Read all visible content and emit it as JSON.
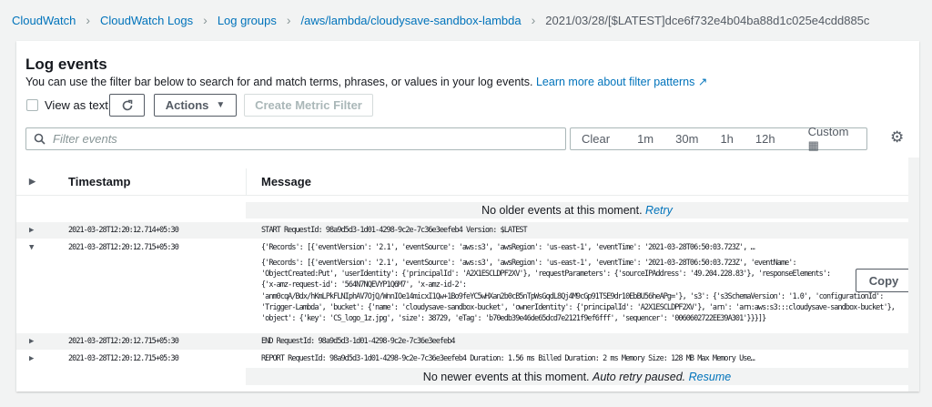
{
  "breadcrumb": [
    "CloudWatch",
    "CloudWatch Logs",
    "Log groups",
    "/aws/lambda/cloudysave-sandbox-lambda",
    "2021/03/28/[$LATEST]dce6f732e4b04ba88d1c025e4cdd885c"
  ],
  "panel": {
    "title": "Log events",
    "description": "You can use the filter bar below to search for and match terms, phrases, or values in your log events.",
    "learn_more": "Learn more about filter patterns"
  },
  "toolbar": {
    "view_as_text": "View as text",
    "actions": "Actions",
    "create_metric_filter": "Create Metric Filter"
  },
  "filter": {
    "placeholder": "Filter events",
    "ranges": [
      "Clear",
      "1m",
      "30m",
      "1h",
      "12h",
      "Custom"
    ]
  },
  "table": {
    "headers": [
      "Timestamp",
      "Message"
    ],
    "no_older": "No older events at this moment.",
    "retry": "Retry",
    "rows": [
      {
        "timestamp": "2021-03-28T12:20:12.714+05:30",
        "message": "START RequestId: 98a9d5d3-1d01-4298-9c2e-7c36e3eefeb4 Version: $LATEST"
      },
      {
        "timestamp": "2021-03-28T12:20:12.715+05:30",
        "message": "{'Records': [{'eventVersion': '2.1', 'eventSource': 'aws:s3', 'awsRegion': 'us-east-1', 'eventTime': '2021-03-28T06:50:03.723Z', …",
        "expanded": true
      },
      {
        "timestamp": "2021-03-28T12:20:12.715+05:30",
        "message": "END RequestId: 98a9d5d3-1d01-4298-9c2e-7c36e3eefeb4"
      },
      {
        "timestamp": "2021-03-28T12:20:12.715+05:30",
        "message": "REPORT RequestId: 98a9d5d3-1d01-4298-9c2e-7c36e3eefeb4 Duration: 1.56 ms Billed Duration: 2 ms Memory Size: 128 MB Max Memory Use…"
      }
    ],
    "detail": "{'Records': [{'eventVersion': '2.1', 'eventSource': 'aws:s3', 'awsRegion': 'us-east-1', 'eventTime': '2021-03-28T06:50:03.723Z', 'eventName':\n'ObjectCreated:Put', 'userIdentity': {'principalId': 'A2X1ESCLDPF2XV'}, 'requestParameters': {'sourceIPAddress': '49.204.228.83'}, 'responseElements':\n{'x-amz-request-id': '564N7NQEVYP1Q6M7', 'x-amz-id-2':\n'anm0cqA/Bdx/hKmLPkFLNIphAV7OjQ/WnnIOe14micxI1Qw+1Bo9feYC5wHXan2b0cB5nTpWsGqdL8Qj4M9cGp91TSE9dr10EbBU56heAPg='}, 's3': {'s3SchemaVersion': '1.0', 'configurationId':\n'Trigger-Lambda', 'bucket': {'name': 'cloudysave-sandbox-bucket', 'ownerIdentity': {'principalId': 'A2X1ESCLDPF2XV'}, 'arn': 'arn:aws:s3:::cloudysave-sandbox-bucket'},\n'object': {'key': 'CS_logo_1z.jpg', 'size': 38729, 'eTag': 'b70edb39e46de65dcd7e2121f9ef6fff', 'sequencer': '0060602722EE39A301'}}}]}",
    "copy": "Copy",
    "no_newer": "No newer events at this moment.",
    "auto_retry": "Auto retry paused.",
    "resume": "Resume"
  }
}
